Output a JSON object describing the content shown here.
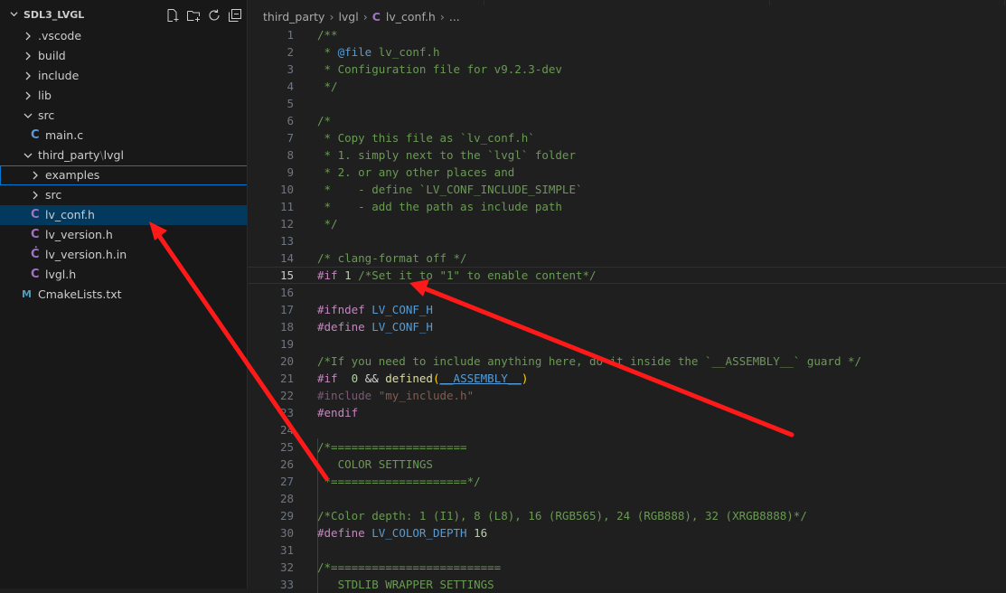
{
  "explorer": {
    "root": "SDL3_LVGL",
    "actions": [
      "new-file-icon",
      "new-folder-icon",
      "refresh-icon",
      "collapse-all-icon"
    ],
    "items": [
      {
        "label": ".vscode",
        "kind": "folder",
        "state": "collapsed",
        "depth": 1
      },
      {
        "label": "build",
        "kind": "folder",
        "state": "collapsed",
        "depth": 1
      },
      {
        "label": "include",
        "kind": "folder",
        "state": "collapsed",
        "depth": 1
      },
      {
        "label": "lib",
        "kind": "folder",
        "state": "collapsed",
        "depth": 1
      },
      {
        "label": "src",
        "kind": "folder",
        "state": "expanded",
        "depth": 1
      },
      {
        "label": "main.c",
        "kind": "c-file",
        "depth": 2
      },
      {
        "label": "third_party",
        "label2": "lvgl",
        "kind": "folder",
        "state": "expanded",
        "depth": 1
      },
      {
        "label": "examples",
        "kind": "folder",
        "state": "collapsed",
        "depth": 2,
        "focused": true
      },
      {
        "label": "src",
        "kind": "folder",
        "state": "collapsed",
        "depth": 2
      },
      {
        "label": "lv_conf.h",
        "kind": "h-file",
        "depth": 2,
        "selected": true
      },
      {
        "label": "lv_version.h",
        "kind": "h-file",
        "depth": 2
      },
      {
        "label": "lv_version.h.in",
        "kind": "h-in-file",
        "depth": 2
      },
      {
        "label": "lvgl.h",
        "kind": "h-file",
        "depth": 2
      },
      {
        "label": "CmakeLists.txt",
        "kind": "cmake-file",
        "depth": 1
      }
    ]
  },
  "breadcrumb": {
    "parts": [
      "third_party",
      "lvgl",
      "lv_conf.h",
      "..."
    ],
    "file_icon": "C"
  },
  "code": {
    "active_line": 15,
    "lines": [
      {
        "n": "1",
        "segs": [
          [
            "c",
            "/**"
          ]
        ]
      },
      {
        "n": "2",
        "segs": [
          [
            "c",
            " * "
          ],
          [
            "m",
            "@file"
          ],
          [
            "c",
            " lv_conf.h"
          ]
        ]
      },
      {
        "n": "3",
        "segs": [
          [
            "c",
            " * Configuration file for v9.2.3-dev"
          ]
        ]
      },
      {
        "n": "4",
        "segs": [
          [
            "c",
            " */"
          ]
        ]
      },
      {
        "n": "5",
        "segs": []
      },
      {
        "n": "6",
        "segs": [
          [
            "c",
            "/*"
          ]
        ]
      },
      {
        "n": "7",
        "segs": [
          [
            "c",
            " * Copy this file as `lv_conf.h`"
          ]
        ]
      },
      {
        "n": "8",
        "segs": [
          [
            "c",
            " * 1. simply next to the `lvgl` folder"
          ]
        ]
      },
      {
        "n": "9",
        "segs": [
          [
            "c",
            " * 2. or any other places and"
          ]
        ]
      },
      {
        "n": "10",
        "segs": [
          [
            "c",
            " *    - define `LV_CONF_INCLUDE_SIMPLE`"
          ]
        ]
      },
      {
        "n": "11",
        "segs": [
          [
            "c",
            " *    - add the path as include path"
          ]
        ]
      },
      {
        "n": "12",
        "segs": [
          [
            "c",
            " */"
          ]
        ]
      },
      {
        "n": "13",
        "segs": []
      },
      {
        "n": "14",
        "segs": [
          [
            "c",
            "/* clang-format off */"
          ]
        ]
      },
      {
        "n": "15",
        "segs": [
          [
            "p",
            "#if"
          ],
          [
            "d",
            " "
          ],
          [
            "n",
            "1"
          ],
          [
            "d",
            " "
          ],
          [
            "c",
            "/*Set it to \"1\" to enable content*/"
          ]
        ]
      },
      {
        "n": "16",
        "segs": []
      },
      {
        "n": "17",
        "segs": [
          [
            "p",
            "#ifndef"
          ],
          [
            "d",
            " "
          ],
          [
            "m",
            "LV_CONF_H"
          ]
        ]
      },
      {
        "n": "18",
        "segs": [
          [
            "p",
            "#define"
          ],
          [
            "d",
            " "
          ],
          [
            "m",
            "LV_CONF_H"
          ]
        ]
      },
      {
        "n": "19",
        "segs": []
      },
      {
        "n": "20",
        "segs": [
          [
            "c",
            "/*If you need to include anything here, do it inside the `__ASSEMBLY__` guard */"
          ]
        ]
      },
      {
        "n": "21",
        "segs": [
          [
            "p",
            "#if"
          ],
          [
            "d",
            "  "
          ],
          [
            "n",
            "0"
          ],
          [
            "d",
            " && "
          ],
          [
            "f",
            "defined"
          ],
          [
            "br",
            "("
          ],
          [
            "m",
            "__ASSEMBLY__"
          ],
          [
            "br",
            ")"
          ]
        ]
      },
      {
        "n": "22",
        "segs": [
          [
            "pd",
            "#include"
          ],
          [
            "sd",
            " \"my_include.h\""
          ]
        ]
      },
      {
        "n": "23",
        "segs": [
          [
            "p",
            "#endif"
          ]
        ]
      },
      {
        "n": "24",
        "segs": []
      },
      {
        "n": "25",
        "segs": [
          [
            "c",
            "/*===================="
          ]
        ]
      },
      {
        "n": "26",
        "segs": [
          [
            "c",
            "   COLOR SETTINGS"
          ]
        ]
      },
      {
        "n": "27",
        "segs": [
          [
            "c",
            " *====================*/"
          ]
        ]
      },
      {
        "n": "28",
        "segs": []
      },
      {
        "n": "29",
        "segs": [
          [
            "c",
            "/*Color depth: 1 (I1), 8 (L8), 16 (RGB565), 24 (RGB888), 32 (XRGB8888)*/"
          ]
        ]
      },
      {
        "n": "30",
        "segs": [
          [
            "p",
            "#define"
          ],
          [
            "d",
            " "
          ],
          [
            "m",
            "LV_COLOR_DEPTH"
          ],
          [
            "d",
            " "
          ],
          [
            "n",
            "16"
          ]
        ]
      },
      {
        "n": "31",
        "segs": []
      },
      {
        "n": "32",
        "segs": [
          [
            "c",
            "/*========================="
          ]
        ]
      },
      {
        "n": "33",
        "segs": [
          [
            "c",
            "   STDLIB WRAPPER SETTINGS"
          ]
        ]
      }
    ]
  },
  "colors": {
    "annotation_arrow": "#ff1a1a",
    "selection": "#04395e",
    "focus_border": "#0078d4"
  }
}
